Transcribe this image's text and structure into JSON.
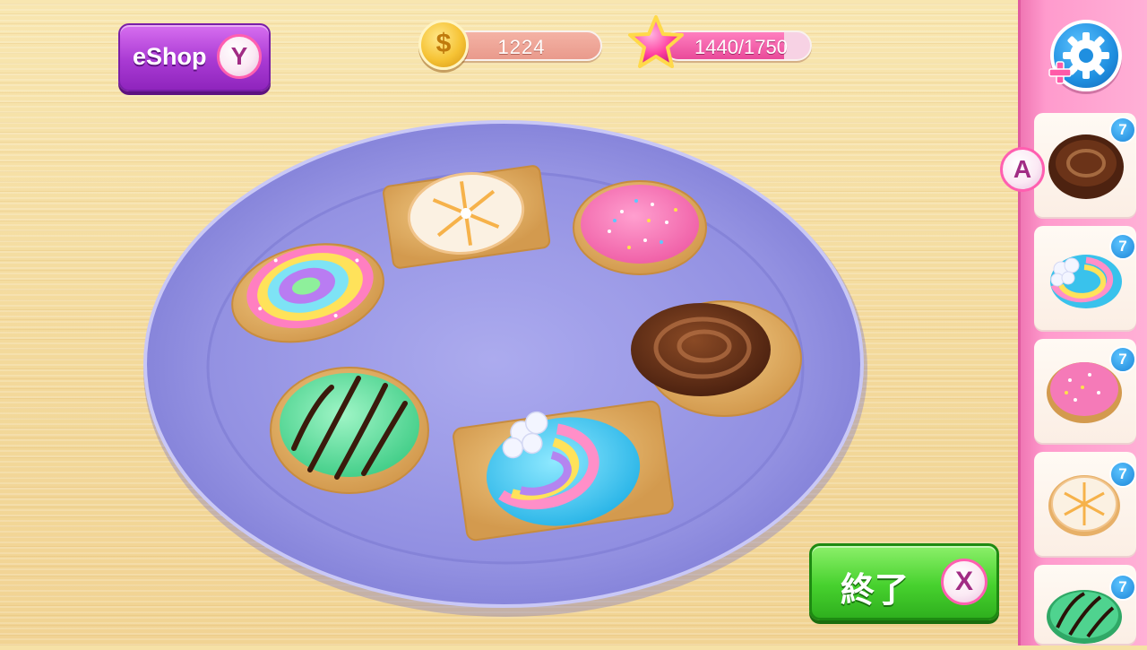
{
  "hud": {
    "eshop_label": "eShop",
    "eshop_button_glyph": "Y",
    "coins_value": "1224",
    "coin_icon": "$",
    "xp_text": "1440/1750",
    "xp_progress": 0.823
  },
  "actions": {
    "end_label": "終了",
    "end_button_glyph": "X",
    "select_button_glyph": "A"
  },
  "panel": {
    "items": [
      {
        "name": "chocolate-swirl-cookie",
        "count": "7"
      },
      {
        "name": "rainbow-cloud-cookie",
        "count": "7"
      },
      {
        "name": "pink-sprinkle-cookie",
        "count": "7"
      },
      {
        "name": "lemon-slice-cookie",
        "count": "7"
      },
      {
        "name": "mint-chocolate-cookie",
        "count": "7"
      }
    ]
  },
  "colors": {
    "eshop_purple": "#a93ad3",
    "end_green": "#47d12e",
    "panel_pink": "#ff9bcd",
    "plate_blue": "#9d9be8",
    "badge_blue": "#1d86d8"
  }
}
